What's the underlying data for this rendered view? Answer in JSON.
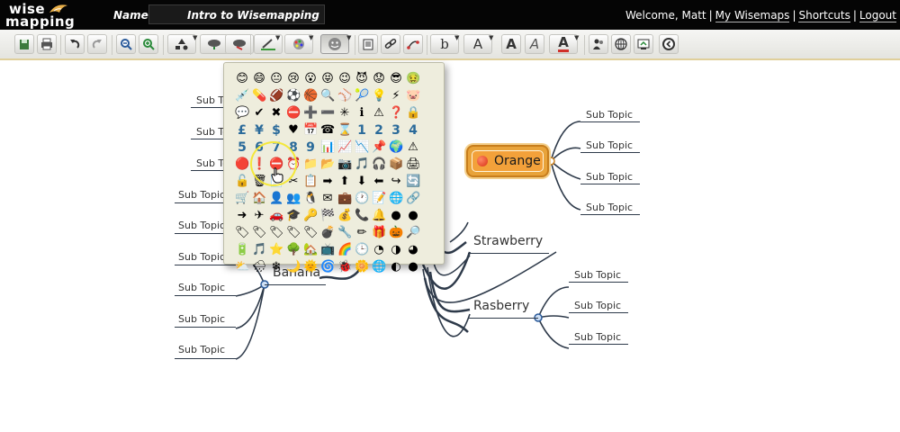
{
  "app": {
    "logo_line1": "wise",
    "logo_line2": "mapping",
    "name_label": "Name:",
    "map_name": "Intro to Wisemapping",
    "welcome": "Welcome, Matt",
    "links": [
      "My Wisemaps",
      "Shortcuts",
      "Logout"
    ]
  },
  "toolbar": {
    "icons": [
      "export-icon",
      "print-icon",
      "undo-icon",
      "redo-icon",
      "zoom-out-icon",
      "zoom-in-icon",
      "shape-icon",
      "add-topic-icon",
      "delete-topic-icon",
      "border-color-icon",
      "fill-color-icon",
      "icon-picker-icon",
      "note-icon",
      "link-icon",
      "relationship-icon",
      "font-family-icon",
      "font-size-icon",
      "bold-icon",
      "italic-icon",
      "font-color-icon",
      "share-icon",
      "publish-icon",
      "history-icon",
      "back-icon"
    ],
    "font_family_label": "b",
    "font_size_label": "A",
    "bold_label": "A",
    "italic_label": "A",
    "font_color_label": "A"
  },
  "mindmap": {
    "central": "Orange",
    "central_color": "#f3a13a",
    "branches": [
      "Strawberry",
      "Banana",
      "Rasberry"
    ],
    "orange_subtopics": [
      "Sub Topic",
      "Sub Topic",
      "Sub Topic",
      "Sub Topic"
    ],
    "rasberry_subtopics": [
      "Sub Topic",
      "Sub Topic",
      "Sub Topic"
    ],
    "banana_subtopics": [
      "Sub Topic",
      "Sub Topic",
      "Sub Topic"
    ],
    "left_subtopics": [
      "Sub Topic",
      "Sub Topic",
      "Sub Topic",
      "Sub Topic",
      "Sub Topic",
      "Sub Topic",
      "Sub Topic",
      "Sub Topic",
      "Sub Topic"
    ]
  },
  "icon_picker": {
    "rows": [
      [
        "😊",
        "😄",
        "😐",
        "😢",
        "😮",
        "😝",
        "😉",
        "😈",
        "😟",
        "😎",
        "🤢"
      ],
      [
        "💉",
        "💊",
        "🏈",
        "⚽",
        "🏀",
        "🔍",
        "⚾",
        "🎾",
        "💡",
        "⚡",
        "🐷"
      ],
      [
        "💬",
        "✔",
        "✖",
        "⛔",
        "➕",
        "➖",
        "✳",
        "ℹ",
        "⚠",
        "❓",
        "🔒"
      ],
      [
        "£",
        "¥",
        "$",
        "♥",
        "📅",
        "☎",
        "⌛",
        "1",
        "2",
        "3",
        "4"
      ],
      [
        "5",
        "6",
        "7",
        "8",
        "9",
        "📊",
        "📈",
        "📉",
        "📌",
        "🌍",
        "⚠"
      ],
      [
        "🔴",
        "❗",
        "⛔",
        "⏰",
        "📁",
        "📂",
        "📷",
        "🎵",
        "🎧",
        "📦",
        "🖨"
      ],
      [
        "🔓",
        "🗑",
        "📄",
        "✂",
        "📋",
        "➡",
        "⬆",
        "⬇",
        "⬅",
        "↪",
        "🔄"
      ],
      [
        "🛒",
        "🏠",
        "👤",
        "👥",
        "🐧",
        "✉",
        "💼",
        "🕐",
        "📝",
        "🌐",
        "🔗"
      ],
      [
        "➜",
        "✈",
        "🚗",
        "🎓",
        "🔑",
        "🏁",
        "💰",
        "📞",
        "🔔",
        "●",
        "●"
      ],
      [
        "🏷",
        "🏷",
        "🏷",
        "🏷",
        "🏷",
        "💣",
        "🔧",
        "✏",
        "🎁",
        "🎃",
        "🔎"
      ],
      [
        "🔋",
        "🎵",
        "⭐",
        "🌳",
        "🏡",
        "📺",
        "🌈",
        "🕒",
        "◔",
        "◑",
        "◕"
      ],
      [
        "⛅",
        "🌧",
        "❄",
        "🌙",
        "🌞",
        "🌀",
        "🐞",
        "🌼",
        "🌐",
        "◐",
        "●"
      ]
    ]
  },
  "colors": {
    "header_bg": "#050505",
    "toolbar_border": "#e0cf9a",
    "connector": "#2e3a4a",
    "highlight": "#f4e83a"
  }
}
